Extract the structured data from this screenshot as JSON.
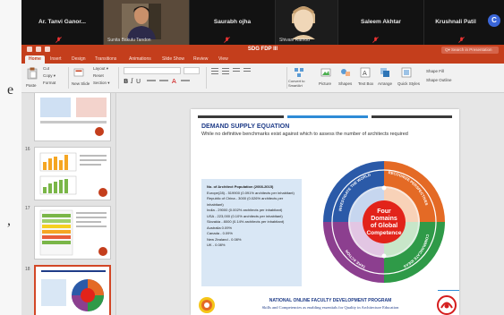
{
  "left_edge": {
    "chars": [
      "e",
      ","
    ]
  },
  "meeting": {
    "participants": [
      {
        "name": "Ar. Tanvi Ganor..."
      },
      {
        "name": "",
        "caption": "Sunita Bakulu Tandon"
      },
      {
        "name": "Saurabh ojha"
      },
      {
        "name": "",
        "caption": "Shivani Rathod"
      },
      {
        "name": "Saleem Akhtar"
      },
      {
        "name": "Krushnali Patil"
      }
    ],
    "more_button": "C"
  },
  "powerpoint": {
    "doc_title": "SDG FDP III",
    "search_placeholder": "Q▾ Search in Presentation",
    "tabs": [
      "Home",
      "Insert",
      "Design",
      "Transitions",
      "Animations",
      "Slide Show",
      "Review",
      "View"
    ],
    "active_tab": "Home",
    "ribbon": {
      "paste": "Paste",
      "cut": "Cut",
      "copy": "Copy ▾",
      "format": "Format",
      "new_slide": "New Slide",
      "layout": "Layout ▾",
      "reset": "Reset",
      "section": "Section ▾",
      "convert_smartart": "Convert to SmartArt",
      "picture": "Picture",
      "shapes": "Shapes",
      "text_box": "Text Box",
      "arrange": "Arrange",
      "quick_styles": "Quick Styles",
      "shape_fill": "Shape Fill",
      "shape_outline": "Shape Outline"
    },
    "thumbnails": [
      {
        "number": ""
      },
      {
        "number": "16"
      },
      {
        "number": "17"
      },
      {
        "number": "18"
      }
    ]
  },
  "slide": {
    "title": "DEMAND SUPPLY EQUATION",
    "subtitle": "While no definitive benchmarks exist against which to assess the number of architects required",
    "info_lines": [
      "No. of Architect Population (2008-2015)",
      "Europe(28) - 519900 (0.091% architects per inhabitant)",
      "Republic of China - 3000 (0.026% architects per inhabitant)",
      "India - 29000 (0.002% architects per inhabitant)",
      "USA - 223,000 (0.10% architects per inhabitant)",
      "Slovakia - 8000 (0.14% architects per inhabitant)",
      "Australia 0.09%",
      "Canada - 0.09%",
      "New Zealand - 0.08%",
      "UK - 0.08%"
    ],
    "wheel": {
      "center": [
        "Four",
        "Domains",
        "of Global",
        "Competence"
      ],
      "segments": [
        "INVESTIGATE THE WORLD",
        "RECOGNIZE PERSPECTIVES",
        "TAKE ACTION",
        "COMMUNICATE IDEAS"
      ]
    },
    "footer": {
      "title": "NATIONAL ONLINE FACULTY DEVELOPMENT PROGRAM",
      "subtitle": "Skills and Competencies as enabling essentials for Quality in Architecture Education"
    }
  },
  "colors": {
    "ppt_accent": "#c43e1c",
    "slide_blue": "#1f3c88",
    "wheel_blue": "#2b5aa8",
    "wheel_orange": "#e46a25",
    "wheel_green": "#2f9a48",
    "wheel_purple": "#8c3f8f",
    "wheel_center": "#e2231a"
  }
}
